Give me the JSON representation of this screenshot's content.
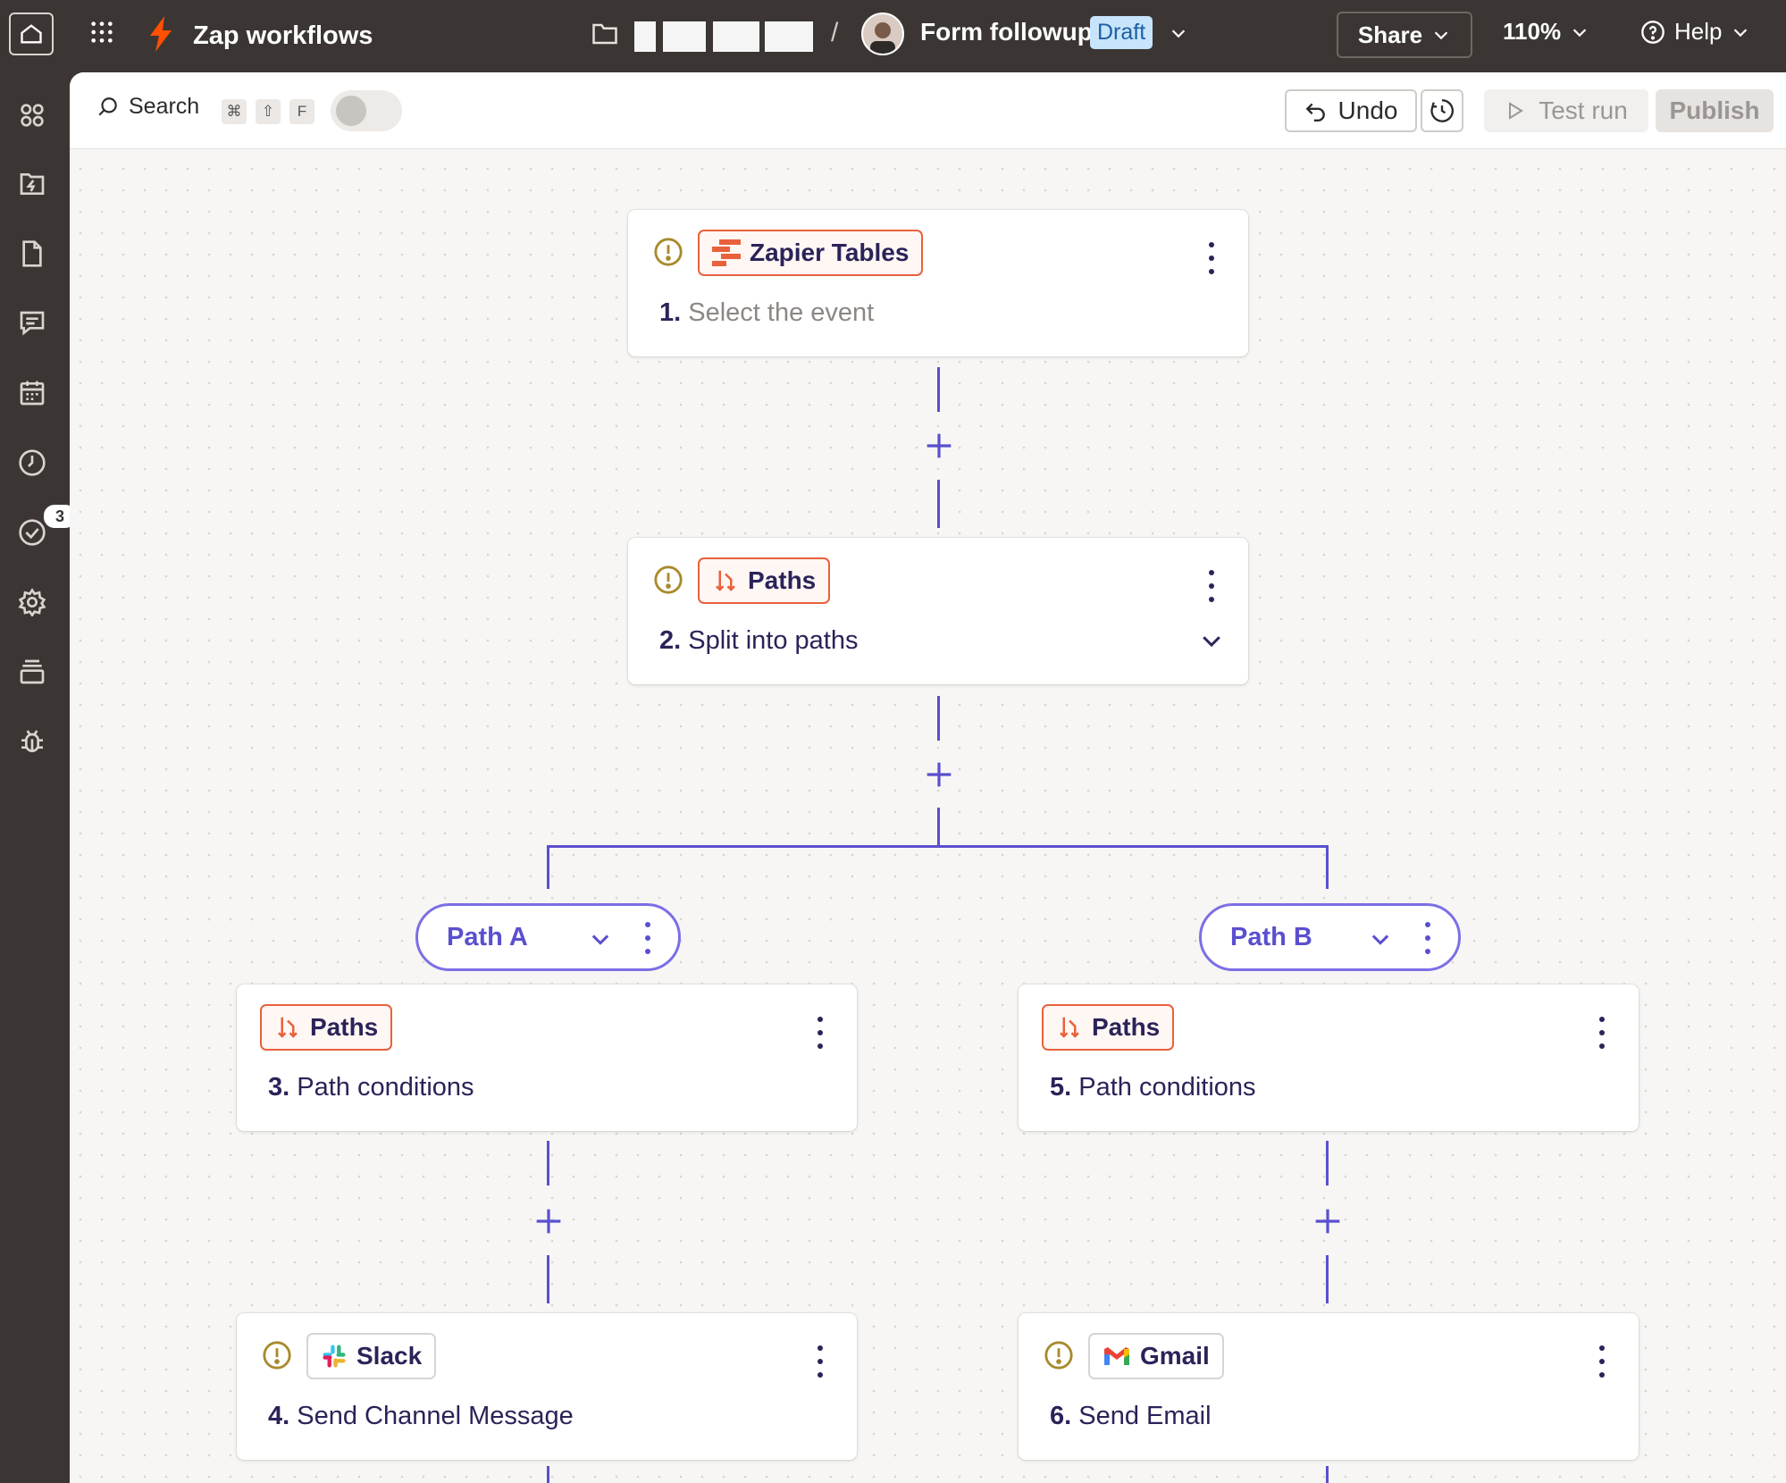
{
  "topbar": {
    "app_title": "Zap workflows",
    "zap_name": "Form followup",
    "status": "Draft",
    "share_label": "Share",
    "zoom_label": "110%",
    "help_label": "Help"
  },
  "rail": {
    "items": [
      "dashboard-icon",
      "zaps-icon",
      "tables-icon",
      "interfaces-icon",
      "canvas-icon",
      "history-icon",
      "updates-icon",
      "settings-icon",
      "layers-icon",
      "debug-icon"
    ],
    "updates_badge": "3"
  },
  "toolbar": {
    "search_label": "Search",
    "keys": [
      "⌘",
      "⇧",
      "F"
    ],
    "undo_label": "Undo",
    "test_run_label": "Test run",
    "publish_label": "Publish"
  },
  "colors": {
    "accent": "#5a4fcf",
    "brand": "#e8613c",
    "warning": "#a88a2c",
    "dark": "#3b3634"
  },
  "steps": [
    {
      "app": "Zapier Tables",
      "number": "1.",
      "title": "Select the event",
      "warning": true
    },
    {
      "app": "Paths",
      "number": "2.",
      "title": "Split into paths",
      "warning": true
    },
    {
      "app": "Paths",
      "number": "3.",
      "title": "Path conditions",
      "warning": false
    },
    {
      "app": "Slack",
      "number": "4.",
      "title": "Send Channel Message",
      "warning": true
    },
    {
      "app": "Paths",
      "number": "5.",
      "title": "Path conditions",
      "warning": false
    },
    {
      "app": "Gmail",
      "number": "6.",
      "title": "Send Email",
      "warning": true
    }
  ],
  "paths": [
    {
      "label": "Path A"
    },
    {
      "label": "Path B"
    }
  ]
}
